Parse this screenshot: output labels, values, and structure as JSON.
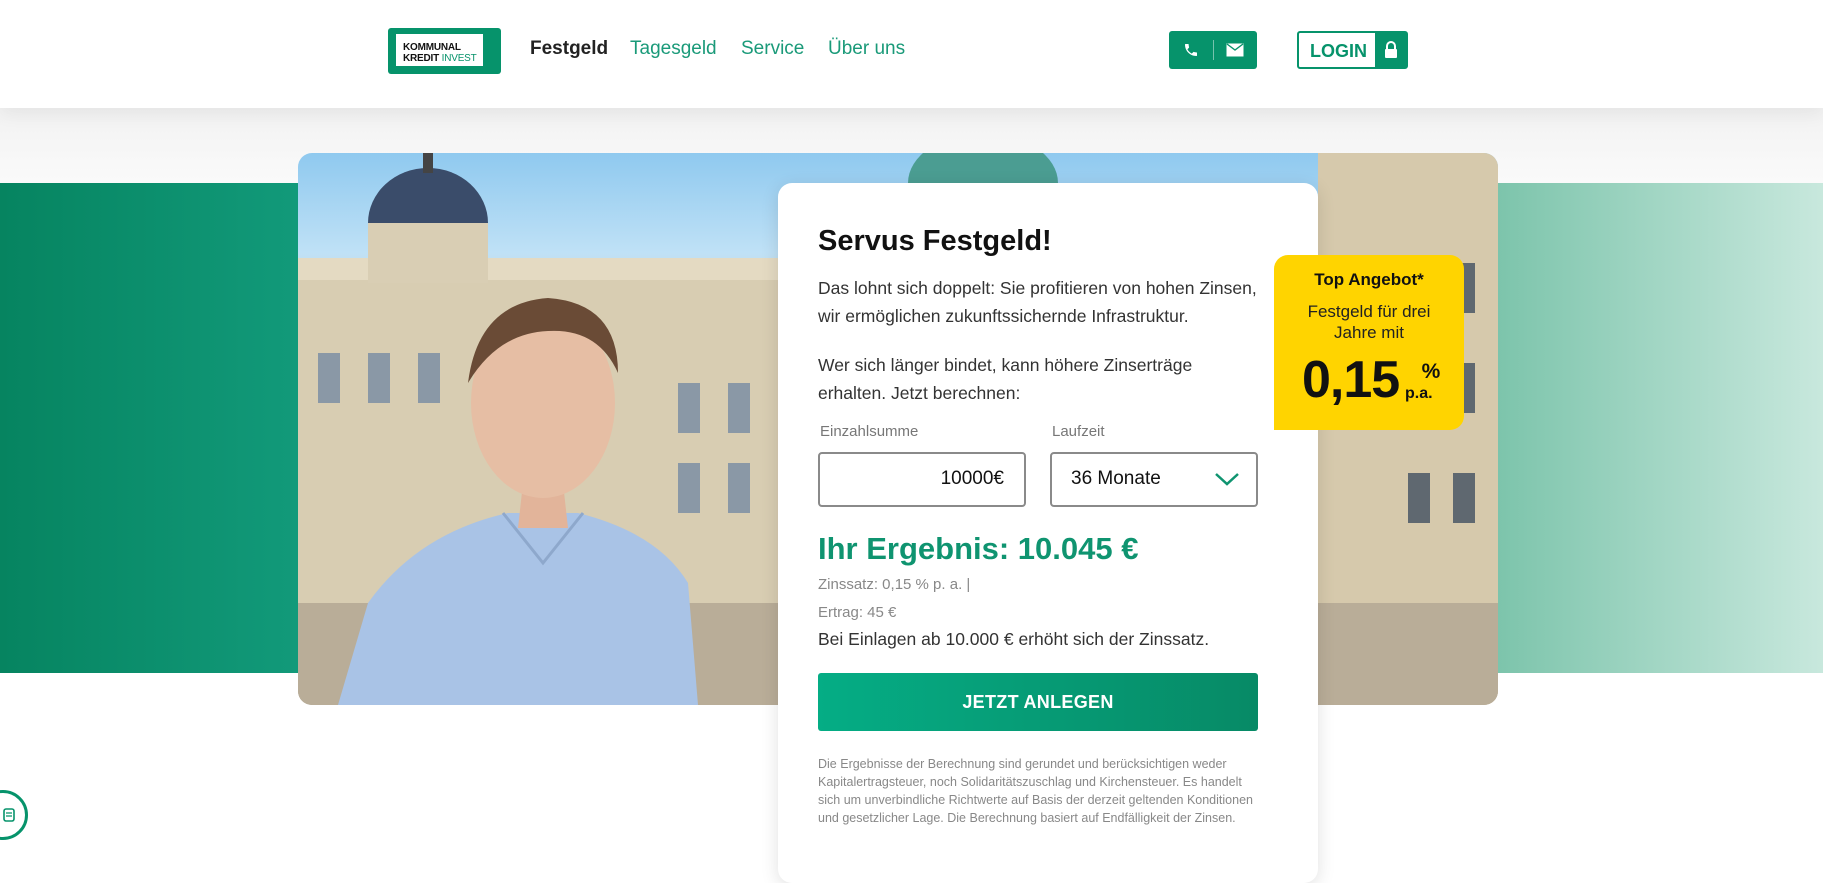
{
  "header": {
    "logo": {
      "line1": "KOMMUNAL",
      "line2a": "KREDIT",
      "line2b": "INVEST"
    },
    "nav": [
      {
        "label": "Festgeld",
        "active": true
      },
      {
        "label": "Tagesgeld",
        "active": false
      },
      {
        "label": "Service",
        "active": false
      },
      {
        "label": "Über uns",
        "active": false
      }
    ],
    "contact_icons": [
      "phone-icon",
      "mail-icon"
    ],
    "login_label": "LOGIN"
  },
  "card": {
    "title": "Servus Festgeld!",
    "intro": "Das lohnt sich doppelt: Sie profitieren von hohen Zinsen, wir ermöglichen zukunftssichernde Infrastruktur.",
    "prompt": "Wer sich länger bindet, kann höhere Zinserträge erhalten. Jetzt berechnen:",
    "deposit_label": "Einzahlsumme",
    "deposit_value": "10000€",
    "term_label": "Laufzeit",
    "term_value": "36 Monate",
    "result": "Ihr Ergebnis: 10.045 €",
    "rate_line": "Zinssatz: 0,15 % p. a.  |",
    "yield_line": "Ertrag: 45 €",
    "hint": "Bei Einlagen ab 10.000 € erhöht sich der Zinssatz.",
    "cta": "JETZT ANLEGEN",
    "disclaimer": "Die Ergebnisse der Berechnung sind gerundet und berücksichtigen weder Kapitalertragsteuer, noch Solidaritätszuschlag und Kirchensteuer. Es handelt sich um unverbindliche Richtwerte auf Basis der derzeit geltenden Konditionen und gesetzlicher Lage. Die Berechnung basiert auf Endfälligkeit der Zinsen."
  },
  "badge": {
    "title": "Top Angebot*",
    "text": "Festgeld für drei Jahre mit",
    "rate": "0,15",
    "percent": "%",
    "pa": "p.a."
  },
  "colors": {
    "brand": "#06936b",
    "badge": "#ffd400",
    "result": "#0f9470"
  }
}
